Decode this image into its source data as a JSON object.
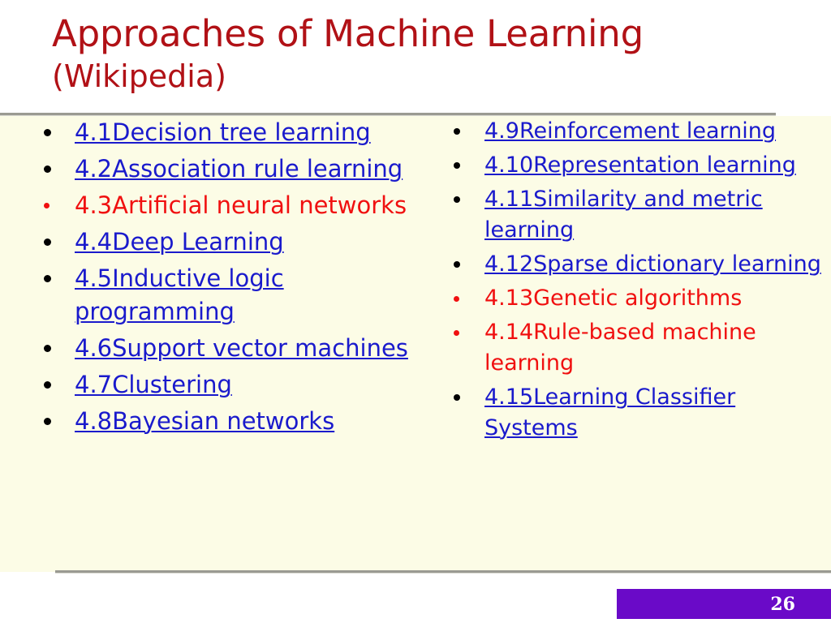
{
  "title": {
    "line1": "Approaches of Machine Learning",
    "line2": "(Wikipedia)",
    "color": "#B11116"
  },
  "colors": {
    "title_red": "#B11116",
    "link_blue": "#1A1ACC",
    "text_red": "#F01010",
    "content_background": "#FCFCE6",
    "slide_background": "#FFFFFF",
    "footer_purple": "#6A0AC8",
    "rule_gray": "#9A9A92"
  },
  "body": {
    "left_column": [
      {
        "label": "4.1Decision tree learning",
        "style": "link",
        "bullet": "black-dot"
      },
      {
        "label": "4.2Association rule learning",
        "style": "link",
        "bullet": "black-dot"
      },
      {
        "label": "4.3Artificial neural networks",
        "style": "plain",
        "bullet": "red-dot"
      },
      {
        "label": "4.4Deep Learning",
        "style": "link",
        "bullet": "black-dot"
      },
      {
        "label": "4.5Inductive logic programming",
        "style": "link",
        "bullet": "black-dot"
      },
      {
        "label": "4.6Support vector machines",
        "style": "link",
        "bullet": "black-dot"
      },
      {
        "label": "4.7Clustering",
        "style": "link",
        "bullet": "black-dot"
      },
      {
        "label": "4.8Bayesian networks",
        "style": "link",
        "bullet": "black-dot"
      }
    ],
    "right_column": [
      {
        "label": "4.9Reinforcement learning",
        "style": "link",
        "bullet": "black-dot"
      },
      {
        "label": "4.10Representation learning",
        "style": "link",
        "bullet": "black-dot"
      },
      {
        "label": "4.11Similarity and metric learning",
        "style": "link",
        "bullet": "black-dot"
      },
      {
        "label": "4.12Sparse dictionary learning",
        "style": "link",
        "bullet": "black-dot"
      },
      {
        "label": "4.13Genetic algorithms",
        "style": "plain",
        "bullet": "red-dot"
      },
      {
        "label": "4.14Rule-based machine learning",
        "style": "plain",
        "bullet": "red-dot"
      },
      {
        "label": "4.15Learning Classifier Systems",
        "style": "link",
        "bullet": "black-dot"
      }
    ]
  },
  "footer": {
    "slide_number": "26"
  }
}
